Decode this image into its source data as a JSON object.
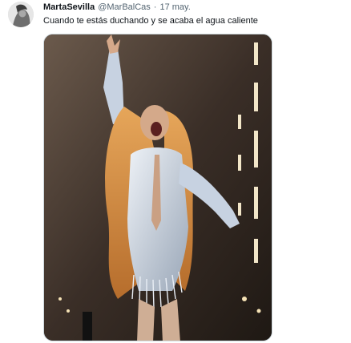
{
  "tweet": {
    "display_name": "MartaSevilla",
    "handle": "@MarBalCas",
    "separator": "·",
    "date": "17 may.",
    "text": "Cuando te estás duchando y se acaba el agua caliente",
    "avatar_icon": "user-avatar-icon",
    "media_icon": "photo-icon"
  },
  "colors": {
    "name": "#0f1419",
    "meta": "#536471",
    "border": "#cfd9de"
  }
}
